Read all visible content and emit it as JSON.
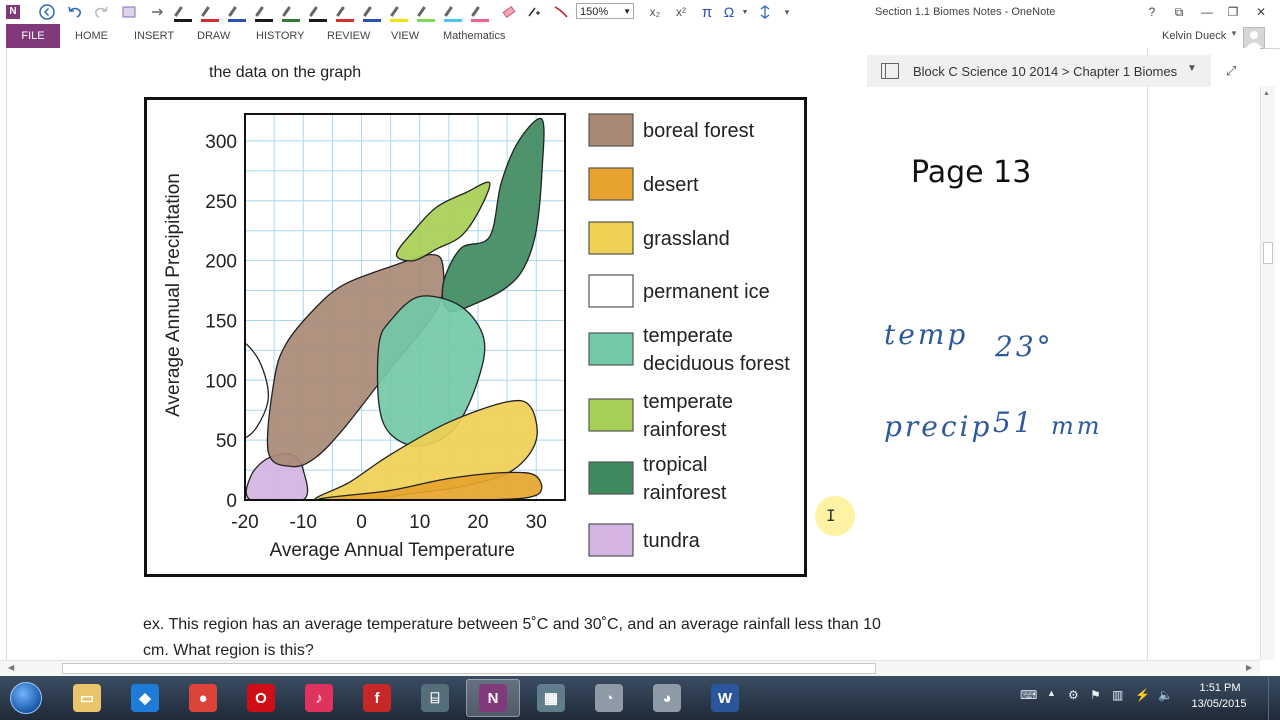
{
  "window": {
    "title": "Section 1.1 Biomes Notes - OneNote",
    "zoom": "150%",
    "user": "Kelvin Dueck",
    "controls": {
      "help": "?",
      "restore_ribbon": "⧉",
      "minimize": "—",
      "maximize": "❐",
      "close": "✕"
    }
  },
  "qat": {
    "subscript": "x₂",
    "superscript": "x²",
    "pi": "π",
    "omega": "Ω"
  },
  "ribbon": {
    "file": "FILE",
    "tabs": [
      "HOME",
      "INSERT",
      "DRAW",
      "HISTORY",
      "REVIEW",
      "VIEW",
      "Mathematics"
    ]
  },
  "pens": [
    "#1a1a1a",
    "#d32f2f",
    "#2a4fb5",
    "#1a1a1a",
    "#2e7d32",
    "#1a1a1a",
    "#d32f2f",
    "#2a4fb5",
    "#f2e600",
    "#7ed957",
    "#4fc3f7",
    "#f06292"
  ],
  "notebook": {
    "breadcrumb": "Block C Science 10 2014 > Chapter 1 Biomes"
  },
  "page": {
    "top_text": "the data on the graph",
    "page_label": "Page 13",
    "handwriting": {
      "line1_a": "temp",
      "line1_b": "23°",
      "line2_a": "precip",
      "line2_b": "51",
      "line2_c": "mm"
    },
    "question_line1": "ex.  This region has an average temperature between 5˚C and 30˚C, and an average rainfall less than 10",
    "question_line2": "cm.  What region is this?"
  },
  "chart_data": {
    "type": "area",
    "xlabel": "Average Annual Temperature",
    "ylabel": "Average Annual Precipitation",
    "xlim": [
      -20,
      30
    ],
    "ylim": [
      0,
      300
    ],
    "x_ticks": [
      -20,
      -10,
      0,
      10,
      20,
      30
    ],
    "y_ticks": [
      0,
      50,
      100,
      150,
      200,
      250,
      300
    ],
    "grid": true,
    "legend_position": "right",
    "legend": [
      {
        "label": "boreal forest",
        "color": "#a98975"
      },
      {
        "label": "desert",
        "color": "#e6a42e"
      },
      {
        "label": "grassland",
        "color": "#f0cf55"
      },
      {
        "label": "permanent ice",
        "color": "#ffffff"
      },
      {
        "label_lines": [
          "temperate",
          "deciduous forest"
        ],
        "color": "#72c9a7"
      },
      {
        "label_lines": [
          "temperate",
          "rainforest"
        ],
        "color": "#a7cf55"
      },
      {
        "label_lines": [
          "tropical",
          "rainforest"
        ],
        "color": "#3f8a5f"
      },
      {
        "label": "tundra",
        "color": "#d3b4e2"
      }
    ],
    "regions": [
      {
        "biome": "tundra",
        "color": "#d3b4e2",
        "points": [
          [
            -19,
            0
          ],
          [
            -19,
            20
          ],
          [
            -16,
            35
          ],
          [
            -12,
            38
          ],
          [
            -10,
            25
          ],
          [
            -10,
            0
          ]
        ]
      },
      {
        "biome": "boreal forest",
        "color": "#a98975",
        "points": [
          [
            -16,
            40
          ],
          [
            -15,
            100
          ],
          [
            -13,
            130
          ],
          [
            -8,
            160
          ],
          [
            -3,
            180
          ],
          [
            5,
            195
          ],
          [
            12,
            205
          ],
          [
            14,
            195
          ],
          [
            13,
            160
          ],
          [
            5,
            110
          ],
          [
            -3,
            60
          ],
          [
            -8,
            35
          ],
          [
            -12,
            28
          ]
        ]
      },
      {
        "biome": "tropical rainforest",
        "color": "#3f8a5f",
        "points": [
          [
            22,
            220
          ],
          [
            24,
            265
          ],
          [
            27,
            300
          ],
          [
            31,
            318
          ],
          [
            31,
            275
          ],
          [
            30,
            225
          ],
          [
            28,
            195
          ],
          [
            25,
            178
          ],
          [
            20,
            165
          ],
          [
            15,
            158
          ],
          [
            14,
            180
          ],
          [
            17,
            210
          ]
        ]
      },
      {
        "biome": "temperate rainforest",
        "color": "#a7cf55",
        "points": [
          [
            6,
            205
          ],
          [
            9,
            225
          ],
          [
            13,
            245
          ],
          [
            18,
            257
          ],
          [
            22,
            265
          ],
          [
            20,
            240
          ],
          [
            17,
            220
          ],
          [
            13,
            210
          ],
          [
            9,
            200
          ]
        ]
      },
      {
        "biome": "temperate deciduous forest",
        "color": "#72c9a7",
        "points": [
          [
            3,
            130
          ],
          [
            3,
            80
          ],
          [
            5,
            55
          ],
          [
            10,
            45
          ],
          [
            16,
            60
          ],
          [
            20,
            100
          ],
          [
            21,
            135
          ],
          [
            17,
            162
          ],
          [
            10,
            170
          ],
          [
            5,
            150
          ]
        ]
      },
      {
        "biome": "grassland",
        "color": "#f0cf55",
        "points": [
          [
            -8,
            0
          ],
          [
            -2,
            15
          ],
          [
            5,
            38
          ],
          [
            15,
            65
          ],
          [
            25,
            82
          ],
          [
            29,
            78
          ],
          [
            30,
            50
          ],
          [
            26,
            25
          ],
          [
            18,
            12
          ],
          [
            8,
            5
          ],
          [
            0,
            0
          ]
        ]
      },
      {
        "biome": "desert",
        "color": "#e6a42e",
        "points": [
          [
            -7,
            0
          ],
          [
            5,
            8
          ],
          [
            15,
            18
          ],
          [
            25,
            23
          ],
          [
            30,
            20
          ],
          [
            30,
            4
          ],
          [
            20,
            0
          ]
        ]
      },
      {
        "biome": "permanent ice",
        "color": "#ffffff",
        "points": [
          [
            -22,
            130
          ],
          [
            -18,
            120
          ],
          [
            -16,
            85
          ],
          [
            -19,
            55
          ],
          [
            -22,
            60
          ]
        ]
      }
    ]
  },
  "taskbar": {
    "apps": [
      {
        "name": "explorer",
        "color": "#e9c46a",
        "glyph": "▭"
      },
      {
        "name": "dropbox",
        "color": "#1f7bd8",
        "glyph": "◆"
      },
      {
        "name": "chrome",
        "color": "#db4437",
        "glyph": "●"
      },
      {
        "name": "opera",
        "color": "#d00e17",
        "glyph": "O"
      },
      {
        "name": "itunes",
        "color": "#e0325f",
        "glyph": "♪"
      },
      {
        "name": "flash",
        "color": "#c62828",
        "glyph": "f"
      },
      {
        "name": "network-tool",
        "color": "#546e7a",
        "glyph": "⌸"
      },
      {
        "name": "onenote",
        "color": "#80397b",
        "glyph": "N"
      },
      {
        "name": "calculator",
        "color": "#607d8b",
        "glyph": "▦"
      },
      {
        "name": "clock-tool-1",
        "color": "#8e9aa6",
        "glyph": "◔"
      },
      {
        "name": "clock-tool-2",
        "color": "#8e9aa6",
        "glyph": "◕"
      },
      {
        "name": "word",
        "color": "#2b579a",
        "glyph": "W"
      }
    ],
    "time": "1:51 PM",
    "date": "13/05/2015"
  }
}
